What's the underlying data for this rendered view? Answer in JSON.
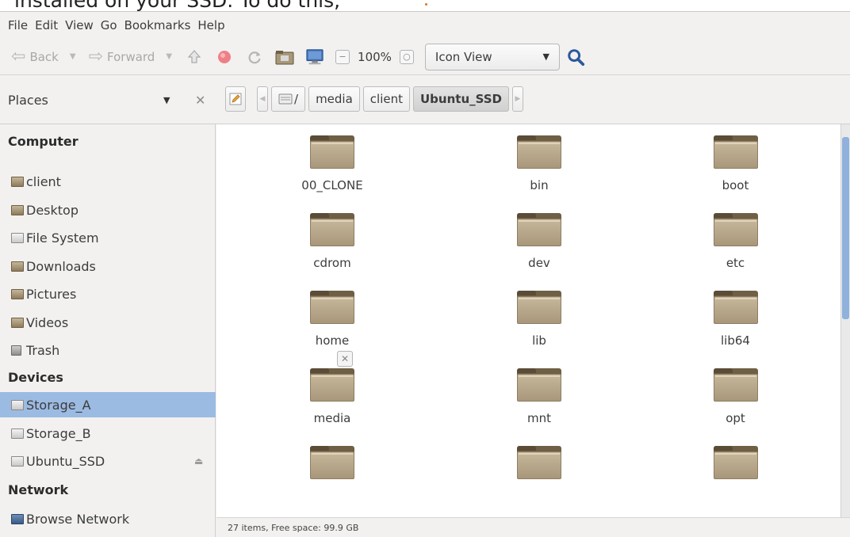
{
  "caption": "installed on your SSD. To do this,",
  "menu": [
    "File",
    "Edit",
    "View",
    "Go",
    "Bookmarks",
    "Help"
  ],
  "toolbar": {
    "back_label": "Back",
    "forward_label": "Forward",
    "zoom_label": "100%",
    "view_mode": "Icon View",
    "icons": [
      "up-icon",
      "stop-icon",
      "reload-icon",
      "home-folder-icon",
      "computer-icon",
      "zoom-out-icon",
      "zoom-reset-icon",
      "search-icon"
    ]
  },
  "places": {
    "title": "Places"
  },
  "breadcrumbs": [
    "/",
    "media",
    "client",
    "Ubuntu_SSD"
  ],
  "sidebar": {
    "sections": [
      {
        "title": "Computer",
        "items": [
          {
            "label": "client",
            "icon": "folder-icon"
          },
          {
            "label": "Desktop",
            "icon": "folder-icon"
          },
          {
            "label": "File System",
            "icon": "drive-icon"
          },
          {
            "label": "Downloads",
            "icon": "folder-icon"
          },
          {
            "label": "Pictures",
            "icon": "folder-icon"
          },
          {
            "label": "Videos",
            "icon": "folder-icon"
          },
          {
            "label": "Trash",
            "icon": "trash-icon"
          }
        ]
      },
      {
        "title": "Devices",
        "items": [
          {
            "label": "Storage_A",
            "icon": "drive-icon",
            "selected": true
          },
          {
            "label": "Storage_B",
            "icon": "drive-icon"
          },
          {
            "label": "Ubuntu_SSD",
            "icon": "drive-icon",
            "eject": true
          }
        ]
      },
      {
        "title": "Network",
        "items": [
          {
            "label": "Browse Network",
            "icon": "network-icon"
          }
        ]
      }
    ]
  },
  "files": [
    "00_CLONE",
    "bin",
    "boot",
    "cdrom",
    "dev",
    "etc",
    "home",
    "lib",
    "lib64",
    "media",
    "mnt",
    "opt",
    "",
    "",
    ""
  ],
  "status": "27 items, Free space: 99.9 GB",
  "colors": {
    "selection": "#9cbbe2",
    "folder": "#b5a486",
    "search_icon": "#2a5a9a"
  }
}
